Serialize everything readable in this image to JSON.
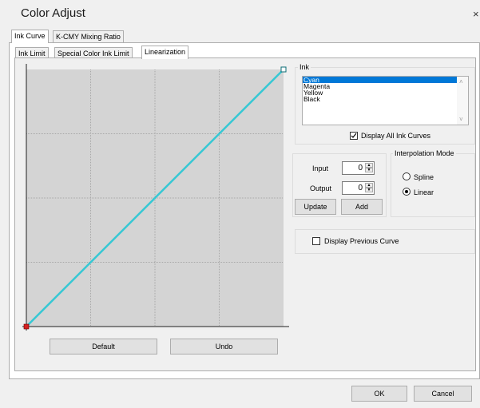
{
  "window": {
    "title": "Color Adjust",
    "close": "×"
  },
  "outer_tabs": [
    {
      "label": "Ink Curve",
      "active": true
    },
    {
      "label": "K-CMY Mixing Ratio",
      "active": false
    }
  ],
  "inner_tabs": [
    {
      "label": "Ink Limit",
      "active": false
    },
    {
      "label": "Special Color Ink Limit",
      "active": false
    },
    {
      "label": "Linearization",
      "active": true
    }
  ],
  "curve": {
    "line_color": "#36c8d4",
    "start_point_color": "#d42020",
    "end_point_color": "#36c8d4",
    "default_label": "Default",
    "undo_label": "Undo"
  },
  "ink": {
    "group_label": "Ink",
    "items": [
      "Cyan",
      "Magenta",
      "Yellow",
      "Black"
    ],
    "selected": "Cyan",
    "display_all_label": "Display All Ink Curves",
    "display_all_checked": true
  },
  "point": {
    "input_label": "Input",
    "input_value": "0",
    "output_label": "Output",
    "output_value": "0",
    "update_label": "Update",
    "add_label": "Add"
  },
  "interpolation": {
    "group_label": "Interpolation Mode",
    "spline_label": "Spline",
    "linear_label": "Linear",
    "selected": "Linear"
  },
  "previous": {
    "label": "Display Previous Curve",
    "checked": false
  },
  "footer": {
    "ok_label": "OK",
    "cancel_label": "Cancel"
  }
}
